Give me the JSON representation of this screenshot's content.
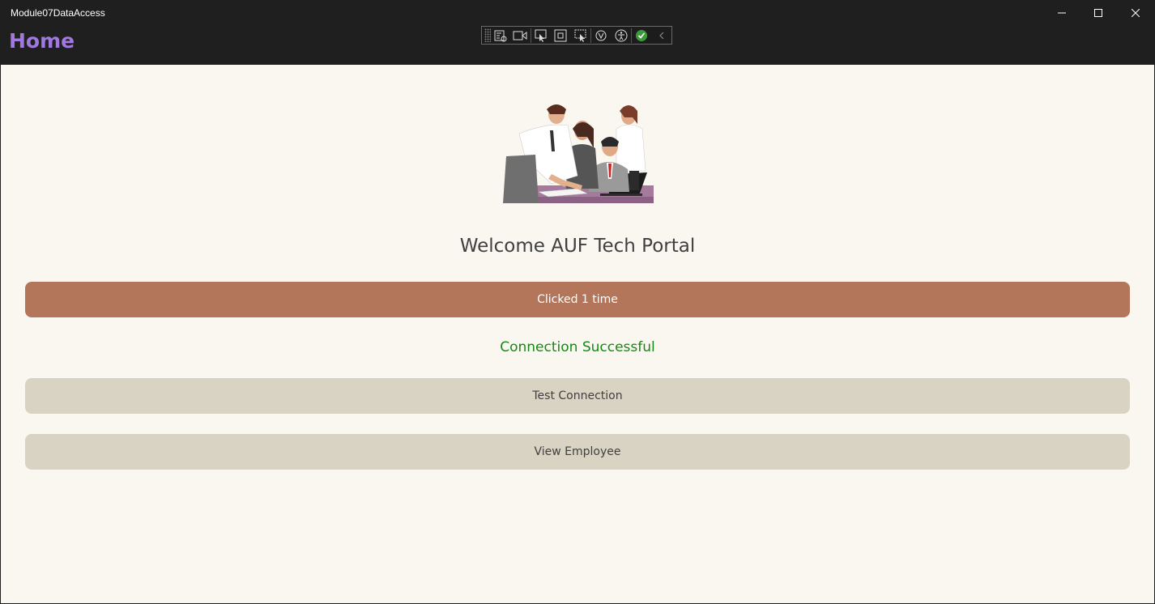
{
  "window": {
    "title": "Module07DataAccess"
  },
  "header": {
    "title": "Home",
    "title_color": "#a078e0"
  },
  "devtools": {
    "icons": [
      "live-visual-tree-icon",
      "video-icon",
      "select-element-icon",
      "display-layout-adorners-icon",
      "track-focus-icon",
      "hot-reload-icon",
      "accessibility-icon",
      "binding-check-icon",
      "collapse-chevron-icon"
    ]
  },
  "main": {
    "welcome_text": "Welcome AUF Tech Portal",
    "counter_button_label": "Clicked 1 time",
    "status_text": "Connection Successful",
    "test_button_label": "Test Connection",
    "view_button_label": "View Employee"
  },
  "colors": {
    "primary": "#b3765b",
    "secondary": "#d9d3c4",
    "success": "#138a13",
    "background": "#faf7f1"
  }
}
